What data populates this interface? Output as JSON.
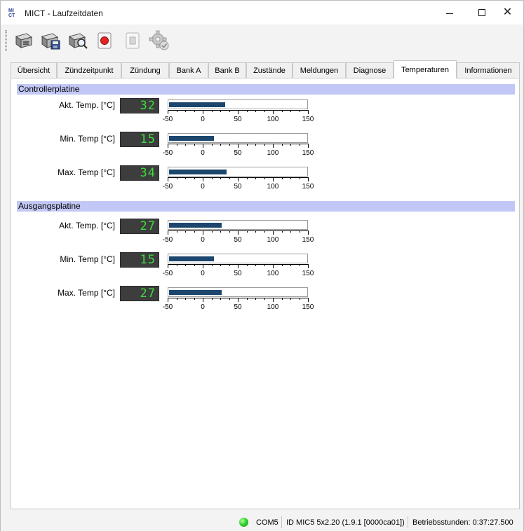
{
  "window": {
    "logo_top": "MI",
    "logo_bottom": "CT",
    "title": "MICT - Laufzeitdaten"
  },
  "toolbar": {
    "buttons": [
      {
        "name": "connect-device-icon"
      },
      {
        "name": "save-data-icon"
      },
      {
        "name": "search-device-icon"
      },
      {
        "name": "record-icon"
      },
      {
        "name": "stop-icon"
      },
      {
        "name": "settings-gear-icon"
      }
    ]
  },
  "tabs": [
    {
      "label": "Übersicht",
      "active": false
    },
    {
      "label": "Zündzeitpunkt",
      "active": false
    },
    {
      "label": "Zündung",
      "active": false
    },
    {
      "label": "Bank A",
      "active": false
    },
    {
      "label": "Bank B",
      "active": false
    },
    {
      "label": "Zustände",
      "active": false
    },
    {
      "label": "Meldungen",
      "active": false
    },
    {
      "label": "Diagnose",
      "active": false
    },
    {
      "label": "Temperaturen",
      "active": true
    },
    {
      "label": "Informationen",
      "active": false
    }
  ],
  "scale": {
    "min": -50,
    "max": 150,
    "labels": [
      "-50",
      "0",
      "50",
      "100",
      "150"
    ]
  },
  "sections": [
    {
      "title": "Controllerplatine",
      "rows": [
        {
          "label": "Akt. Temp. [°C]",
          "value": "32",
          "numeric": 32
        },
        {
          "label": "Min. Temp [°C]",
          "value": "15",
          "numeric": 15
        },
        {
          "label": "Max. Temp [°C]",
          "value": "34",
          "numeric": 34
        }
      ]
    },
    {
      "title": "Ausgangsplatine",
      "rows": [
        {
          "label": "Akt. Temp. [°C]",
          "value": "27",
          "numeric": 27
        },
        {
          "label": "Min. Temp [°C]",
          "value": "15",
          "numeric": 15
        },
        {
          "label": "Max. Temp [°C]",
          "value": "27",
          "numeric": 27
        }
      ]
    }
  ],
  "statusbar": {
    "port": "COM5",
    "device_id": "ID MIC5 5x2.20 (1.9.1 [0000ca01])",
    "operating_hours": "Betriebsstunden: 0:37:27.500",
    "connection_color": "#33d433"
  },
  "colors": {
    "section_header": "#c2c8f5",
    "gauge_fill": "#1c466e",
    "led_background": "#3d3d3d",
    "led_digits": "#3ddc3d"
  }
}
